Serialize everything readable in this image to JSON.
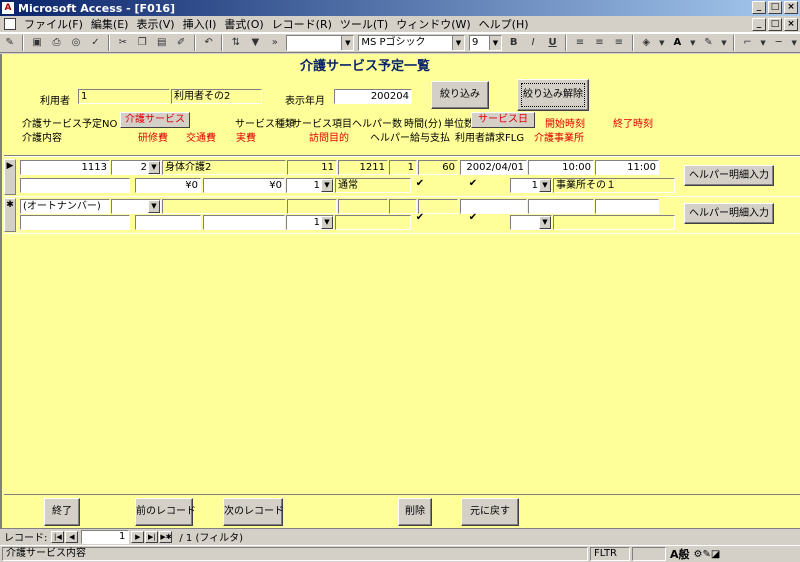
{
  "window": {
    "title": "Microsoft Access - [F016]",
    "buttons": [
      "_",
      "□",
      "×"
    ]
  },
  "menu": {
    "items": [
      "ファイル(F)",
      "編集(E)",
      "表示(V)",
      "挿入(I)",
      "書式(O)",
      "レコード(R)",
      "ツール(T)",
      "ウィンドウ(W)",
      "ヘルプ(H)"
    ],
    "doc_buttons": [
      "_",
      "□",
      "×"
    ]
  },
  "toolbar": {
    "font_name": "MS Pゴシック",
    "font_size": "9",
    "bold": "B",
    "italic": "I",
    "underline": "U",
    "more": "»"
  },
  "form": {
    "title": "介護サービス予定一覧",
    "filter": {
      "user_label": "利用者",
      "user_id": "1",
      "user_name": "利用者その2",
      "year_month_label": "表示年月",
      "year_month": "200204",
      "filter_button": "絞り込み",
      "clear_button": "絞り込み解除"
    },
    "headers": {
      "row1": {
        "plan_no": "介護サービス予定NO",
        "care_service": "介護サービス",
        "service_type": "サービス種類",
        "service_item": "サービス項目",
        "helper_count": "ヘルパー数",
        "minutes": "時間(分)",
        "units": "単位数",
        "service_date": "サービス日",
        "start_time": "開始時刻",
        "end_time": "終了時刻"
      },
      "row2": {
        "care_content": "介護内容",
        "training_fee": "研修費",
        "transport_fee": "交通費",
        "actual_cost": "実費",
        "visit_purpose": "訪問目的",
        "helper_pay": "ヘルパー給与支払",
        "user_billing": "利用者請求FLG",
        "provider": "介護事業所"
      }
    },
    "record": {
      "plan_no": "1113",
      "service_code": "2",
      "service_name": "身体介護2",
      "service_type": "11",
      "service_item": "1211",
      "helper_count": "1",
      "minutes": "60",
      "service_date": "2002/04/01",
      "start_time": "10:00",
      "end_time": "11:00",
      "care_content": "",
      "training_fee": "¥0",
      "transport_fee": "¥0",
      "actual_cost": "",
      "visit_purpose_code": "1",
      "visit_purpose": "通常",
      "helper_pay": true,
      "user_billing": true,
      "provider_code": "1",
      "provider_name": "事業所その１",
      "detail_button": "ヘルパー明細入力"
    },
    "new_record": {
      "plan_no": "(オートナンバー)",
      "visit_purpose_code": "1",
      "helper_pay": true,
      "user_billing": true,
      "detail_button": "ヘルパー明細入力"
    },
    "footer_buttons": {
      "close": "終了",
      "prev": "前のレコード",
      "next": "次のレコード",
      "delete": "削除",
      "undo": "元に戻す"
    }
  },
  "navigation": {
    "label": "レコード:",
    "current": "1",
    "total": "/ 1 (フィルタ)"
  },
  "status": {
    "text": "介護サービス内容",
    "mode": "FLTR",
    "ime": "A般"
  },
  "colors": {
    "form_bg": "#ffff99",
    "accent_red": "#e00000",
    "title_blue": "#0a246a"
  }
}
